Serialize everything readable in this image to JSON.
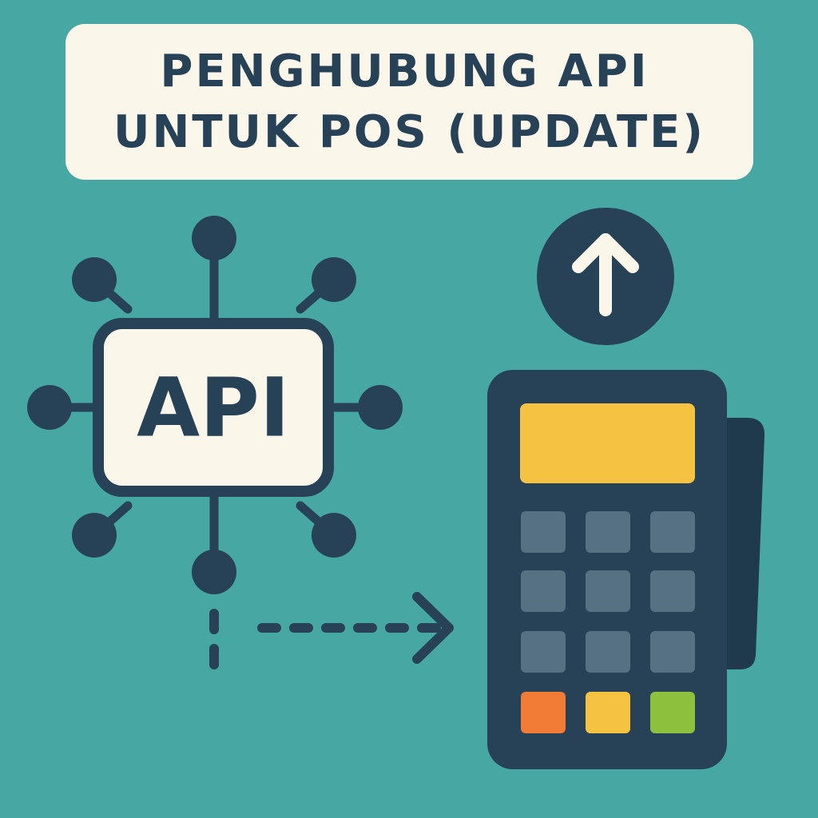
{
  "title": {
    "line1": "PENGHUBUNG API",
    "line2": "UNTUK POS (UPDATE)"
  },
  "api_hub": {
    "label": "API",
    "icon": "api-hub-icon"
  },
  "update_badge": {
    "icon": "arrow-up-icon"
  },
  "pos_terminal": {
    "icon": "pos-terminal-icon",
    "keypad": {
      "rows": 3,
      "cols": 3
    },
    "function_keys": [
      "orange",
      "yellow",
      "green"
    ]
  },
  "connector": {
    "icon": "dashed-arrow-right-icon"
  },
  "colors": {
    "background": "#47a8a3",
    "navy": "#274156",
    "cream": "#fbf6ea",
    "screen_yellow": "#f6c241",
    "key_gray": "#567182",
    "key_orange": "#f27b35",
    "key_yellow": "#f6c241",
    "key_green": "#8dc03d",
    "side_panel": "#1f3a4c"
  }
}
